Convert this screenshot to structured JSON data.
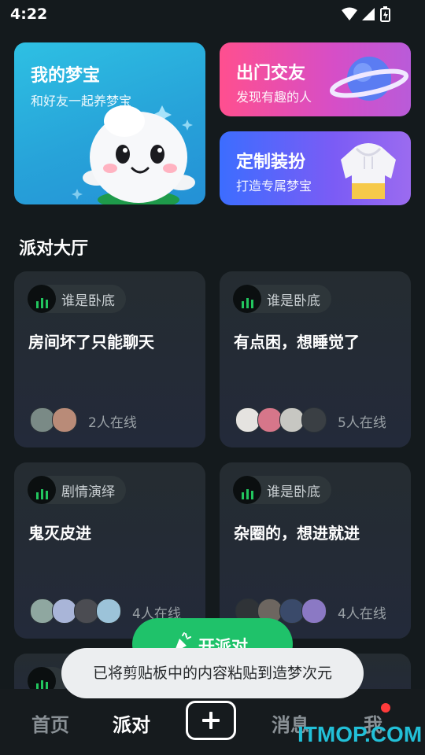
{
  "status": {
    "time": "4:22"
  },
  "features": {
    "my_dream": {
      "title": "我的梦宝",
      "subtitle": "和好友一起养梦宝"
    },
    "go_out": {
      "title": "出门交友",
      "subtitle": "发现有趣的人"
    },
    "outfit": {
      "title": "定制装扮",
      "subtitle": "打造专属梦宝"
    }
  },
  "section": {
    "title": "派对大厅"
  },
  "rooms": [
    {
      "tag": "谁是卧底",
      "title": "房间坏了只能聊天",
      "online": "2人在线"
    },
    {
      "tag": "谁是卧底",
      "title": "有点困，想睡觉了",
      "online": "5人在线"
    },
    {
      "tag": "剧情演绎",
      "title": "鬼灭皮进",
      "online": "4人在线"
    },
    {
      "tag": "谁是卧底",
      "title": "杂圈的，想进就进",
      "online": "4人在线"
    }
  ],
  "fab": {
    "label": "开派对"
  },
  "toast": {
    "text": "已将剪贴板中的内容粘贴到造梦次元"
  },
  "nav": {
    "home": "首页",
    "party": "派对",
    "messages": "消息",
    "me": "我"
  },
  "watermark": "ITMOP.COM",
  "colors": {
    "accent_green": "#1fc26a",
    "background": "#141a1d",
    "badge_red": "#ff3b3b"
  }
}
